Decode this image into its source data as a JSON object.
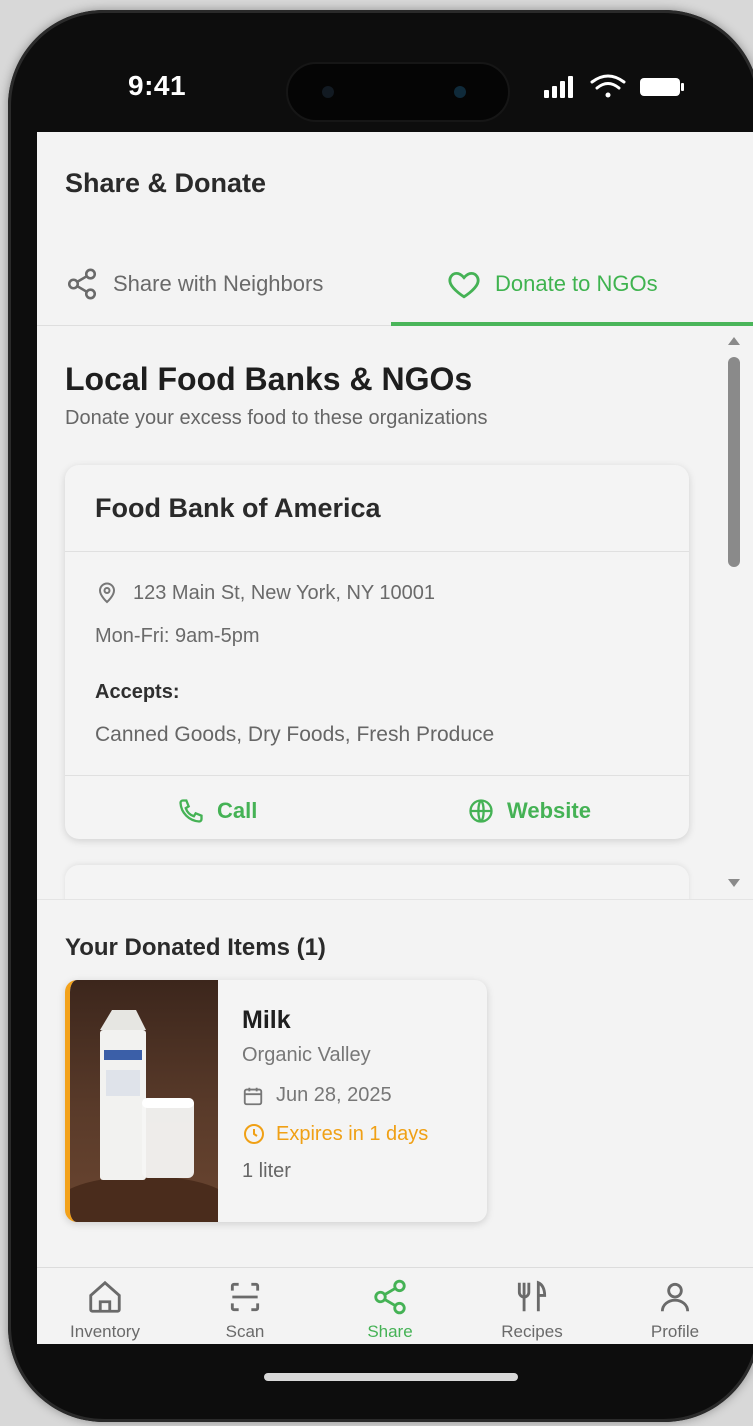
{
  "status": {
    "time": "9:41"
  },
  "header": {
    "title": "Share & Donate"
  },
  "tabs": [
    {
      "label": "Share with Neighbors",
      "icon": "share-icon",
      "active": false
    },
    {
      "label": "Donate to NGOs",
      "icon": "heart-icon",
      "active": true
    }
  ],
  "ngos": {
    "title": "Local Food Banks & NGOs",
    "subtitle": "Donate your excess food to these organizations",
    "items": [
      {
        "name": "Food Bank of America",
        "address": "123 Main St, New York, NY 10001",
        "hours": "Mon-Fri: 9am-5pm",
        "accepts_label": "Accepts:",
        "accepts": "Canned Goods, Dry Foods, Fresh Produce",
        "call_label": "Call",
        "website_label": "Website"
      }
    ]
  },
  "donated": {
    "title": "Your Donated Items (1)",
    "items": [
      {
        "name": "Milk",
        "brand": "Organic Valley",
        "date": "Jun 28, 2025",
        "expiry": "Expires in 1 days",
        "quantity": "1 liter"
      }
    ]
  },
  "nav": [
    {
      "label": "Inventory",
      "icon": "home-icon",
      "active": false
    },
    {
      "label": "Scan",
      "icon": "scan-icon",
      "active": false
    },
    {
      "label": "Share",
      "icon": "share-icon",
      "active": true
    },
    {
      "label": "Recipes",
      "icon": "utensils-icon",
      "active": false
    },
    {
      "label": "Profile",
      "icon": "user-icon",
      "active": false
    }
  ],
  "colors": {
    "accent": "#45b255",
    "warning": "#f0a015",
    "text": "#2a2a2a"
  }
}
